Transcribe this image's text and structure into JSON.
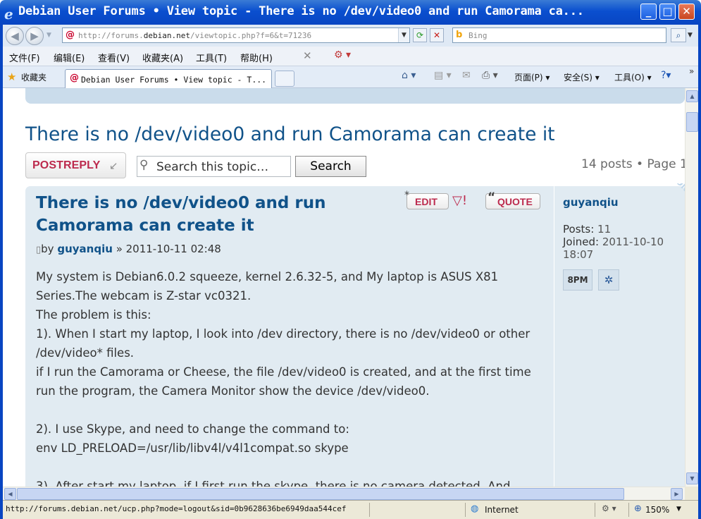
{
  "window": {
    "title": "Debian User Forums • View topic - There is no /dev/video0 and run Camorama ca...",
    "buttons": {
      "minimize": "_",
      "maximize": "□",
      "close": "✕"
    }
  },
  "addressbar": {
    "url_prefix": "http://forums.",
    "url_domain": "debian.net",
    "url_path": "/viewtopic.php?f=6&t=71236",
    "search_placeholder": "Bing"
  },
  "menubar": {
    "items": [
      "文件(F)",
      "编辑(E)",
      "查看(V)",
      "收藏夹(A)",
      "工具(T)",
      "帮助(H)"
    ]
  },
  "favbar": {
    "favorites_label": "收藏夹",
    "tab_title": "Debian User Forums • View topic - T...",
    "commands": [
      "页面(P)",
      "安全(S)",
      "工具(O)"
    ]
  },
  "page": {
    "topic_title": "There is no /dev/video0 and run Camorama can create it",
    "postreply_label": "POSTREPLY",
    "search_placeholder": "Search this topic…",
    "search_button": "Search",
    "pagination": "14 posts • Page 1"
  },
  "post": {
    "title": "There is no /dev/video0 and run Camorama can create it",
    "edit_label": "EDIT",
    "quote_label": "QUOTE",
    "by_label": "by",
    "author": "guyanqiu",
    "date": "» 2011-10-11 02:48",
    "body": [
      "My system is Debian6.0.2 squeeze, kernel 2.6.32-5, and My laptop is ASUS X81 Series.The webcam is Z-star vc0321.",
      "The problem is this:",
      "1). When I start my laptop, I look into /dev directory, there is no /dev/video0 or other /dev/video* files.",
      "if I run the Camorama or Cheese, the file /dev/video0 is created, and at the first time run the program, the Camera Monitor show the device /dev/video0.",
      "",
      "2). I use Skype, and need to change the command to:",
      "env LD_PRELOAD=/usr/lib/libv4l/v4l1compat.so skype",
      "",
      "3). After start my laptop, if I first run the skype, there is no camera detected. And"
    ]
  },
  "profile": {
    "username": "guyanqiu",
    "posts_label": "Posts:",
    "posts_value": "11",
    "joined_label": "Joined:",
    "joined_value": "2011-10-10 18:07",
    "pm_label": "PM",
    "online_label": "ONLINE"
  },
  "statusbar": {
    "url": "http://forums.debian.net/ucp.php?mode=logout&sid=0b9628636be6949daa544cef",
    "zone": "Internet",
    "zoom": "150%"
  }
}
